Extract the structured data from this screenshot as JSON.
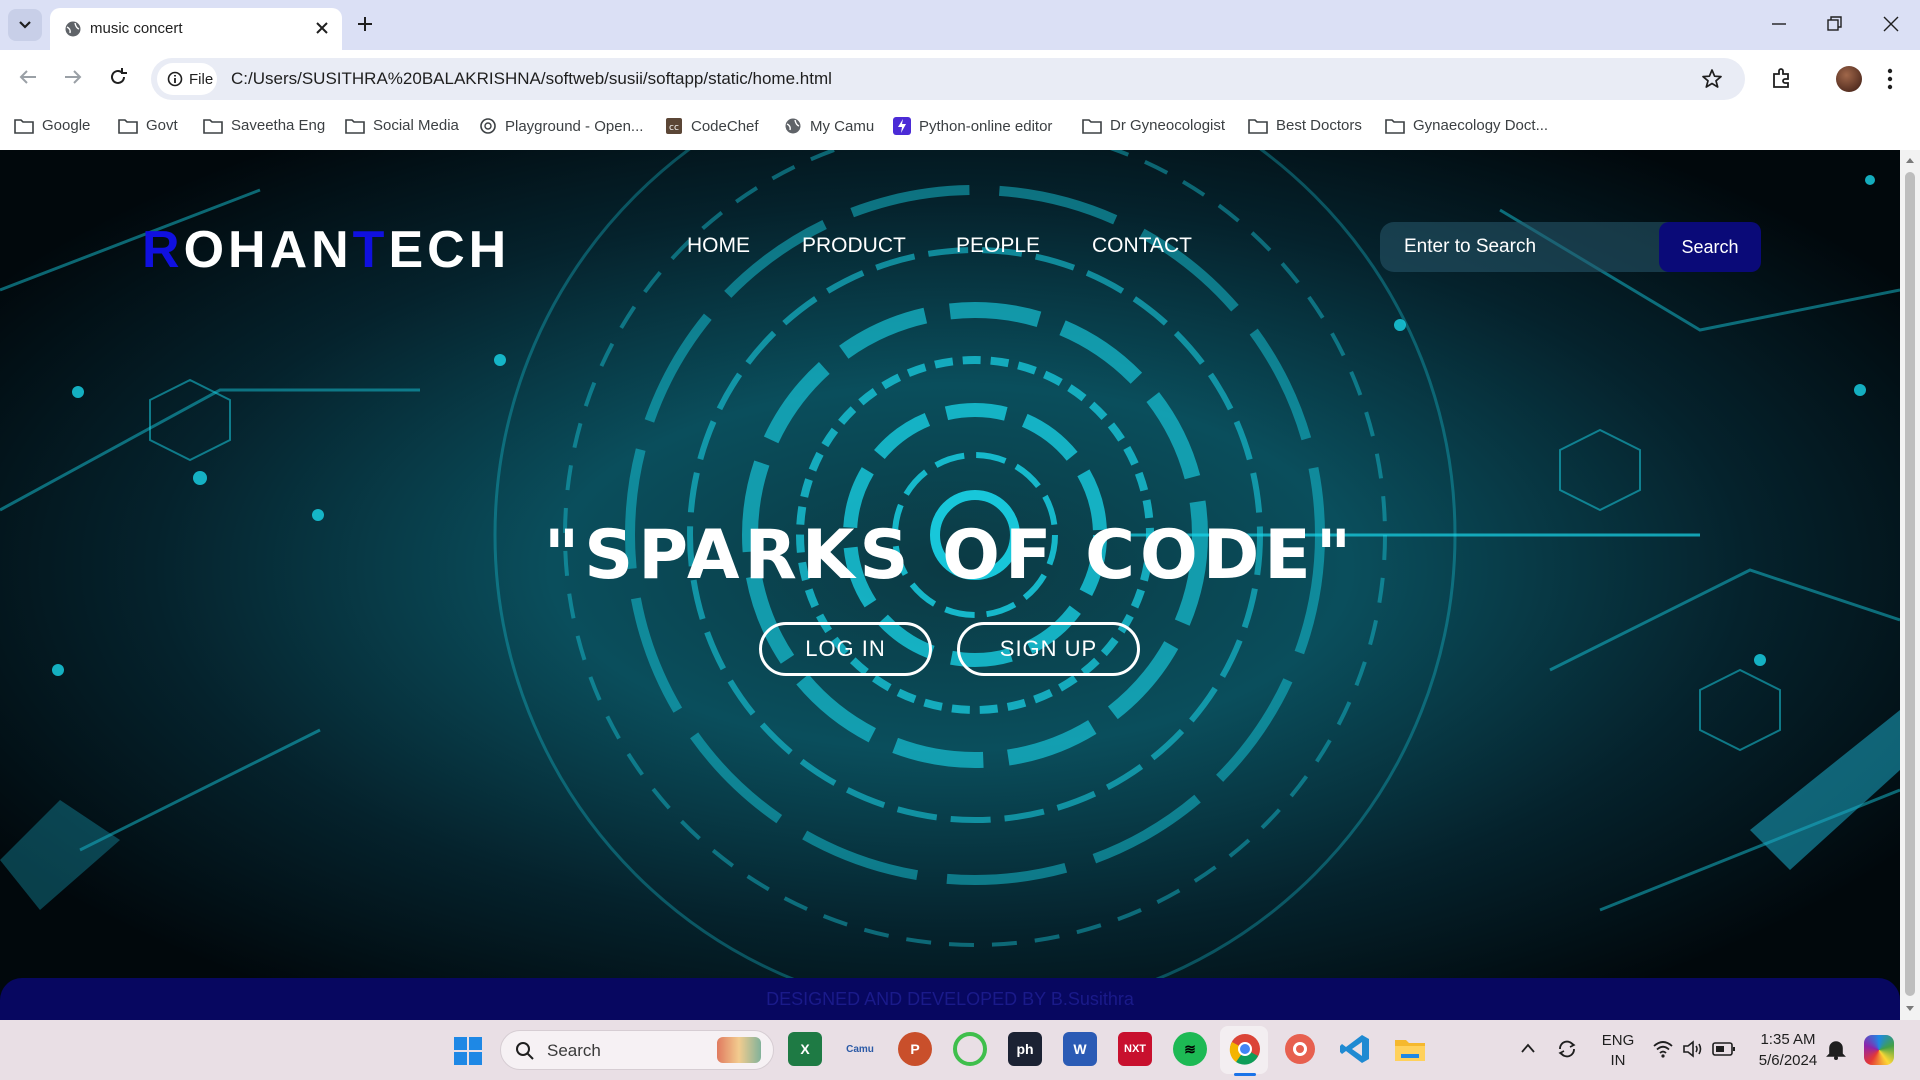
{
  "browser": {
    "tab_title": "music concert",
    "omnibox": {
      "chip_label": "File",
      "url": "C:/Users/SUSITHRA%20BALAKRISHNA/softweb/susii/softapp/static/home.html"
    },
    "bookmarks": [
      {
        "label": "Google",
        "icon": "folder-icon"
      },
      {
        "label": "Govt",
        "icon": "folder-icon"
      },
      {
        "label": "Saveetha Eng",
        "icon": "folder-icon"
      },
      {
        "label": "Social Media",
        "icon": "folder-icon"
      },
      {
        "label": "Playground - Open...",
        "icon": "openai-icon"
      },
      {
        "label": "CodeChef",
        "icon": "codechef-icon"
      },
      {
        "label": "My Camu",
        "icon": "globe-icon"
      },
      {
        "label": "Python-online editor",
        "icon": "bolt-icon"
      },
      {
        "label": "Dr Gyneocologist",
        "icon": "folder-icon"
      },
      {
        "label": "Best Doctors",
        "icon": "folder-icon"
      },
      {
        "label": "Gynaecology Doct...",
        "icon": "folder-icon"
      }
    ]
  },
  "page": {
    "logo": {
      "r": "R",
      "ohan": "OHAN",
      "t": "T",
      "ech": "ECH"
    },
    "nav": [
      "HOME",
      "PRODUCT",
      "PEOPLE",
      "CONTACT"
    ],
    "search": {
      "placeholder": "Enter to Search",
      "button": "Search"
    },
    "headline": "\"SPARKS OF CODE\"",
    "login_label": "LOG IN",
    "signup_label": "SIGN UP",
    "footer": "DESIGNED AND DEVELOPED BY B.Susithra",
    "colors": {
      "logo_accent": "#1010e0",
      "search_button": "#0a0a78",
      "footer_bg": "#070760",
      "theme_cyan": "#19d6ea"
    }
  },
  "taskbar": {
    "search_label": "Search",
    "apps": [
      "excel-icon",
      "camu-icon",
      "powerpoint-icon",
      "circle-app-icon",
      "ph-app-icon",
      "word-icon",
      "sunnxt-icon",
      "spotify-icon",
      "chrome-icon",
      "chrome-alt-icon",
      "vscode-icon",
      "file-explorer-icon"
    ],
    "lang_top": "ENG",
    "lang_bottom": "IN",
    "time": "1:35 AM",
    "date": "5/6/2024"
  }
}
